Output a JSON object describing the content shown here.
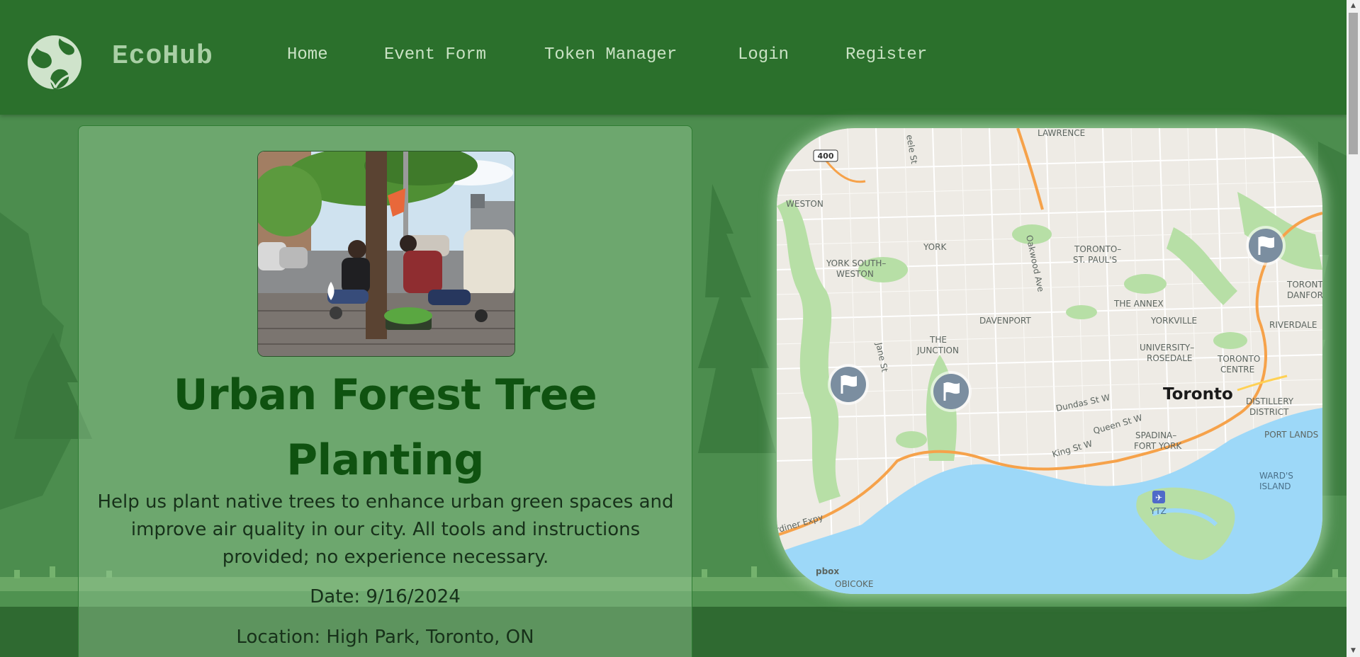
{
  "header": {
    "brand": "EcoHub",
    "logo_icon": "earth-leaves-icon",
    "nav": [
      {
        "label": "Home"
      },
      {
        "label": "Event Form"
      },
      {
        "label": "Token Manager"
      },
      {
        "label": "Login"
      },
      {
        "label": "Register"
      }
    ]
  },
  "event": {
    "title": "Urban Forest Tree Planting",
    "description": "Help us plant native trees to enhance urban green spaces and improve air quality in our city. All tools and instructions provided; no experience necessary.",
    "date": "Date: 9/16/2024",
    "location": "Location: High Park, Toronto, ON",
    "photo_alt": "Volunteers planting a tree on a city sidewalk"
  },
  "map": {
    "city": "Toronto",
    "pin_icon": "flag-pin-icon",
    "labels": {
      "lawrence": "LAWRENCE",
      "keele": "eele St",
      "hwy400": "400",
      "weston": "WESTON",
      "york": "YORK",
      "york_south1": "YORK SOUTH–",
      "york_south2": "WESTON",
      "oakwood": "Oakwood Ave",
      "stpauls1": "TORONTO–",
      "stpauls2": "ST. PAUL'S",
      "annex": "THE ANNEX",
      "yorkville": "YORKVILLE",
      "davenport": "DAVENPORT",
      "junction1": "THE",
      "junction2": "JUNCTION",
      "jane": "Jane St",
      "rosedale1": "UNIVERSITY–",
      "rosedale2": "ROSEDALE",
      "tcentre1": "TORONTO",
      "tcentre2": "CENTRE",
      "danforth1": "TORONT",
      "danforth2": "DANFOR",
      "riverdale": "RIVERDALE",
      "dundas": "Dundas St W",
      "queen": "Queen St W",
      "king": "King St W",
      "spadina1": "SPADINA–",
      "spadina2": "FORT YORK",
      "distillery1": "DISTILLERY",
      "distillery2": "DISTRICT",
      "portlands": "PORT LANDS",
      "wards1": "WARD'S",
      "wards2": "ISLAND",
      "ytz": "YTZ",
      "gardiner": "rdiner Expy",
      "etobicoke": "OBICOKE",
      "mapbox": "pbox"
    }
  },
  "colors": {
    "header": "#2b702c",
    "title": "#0f5210",
    "water": "#9dd8f8",
    "highway": "#f6a24a"
  }
}
